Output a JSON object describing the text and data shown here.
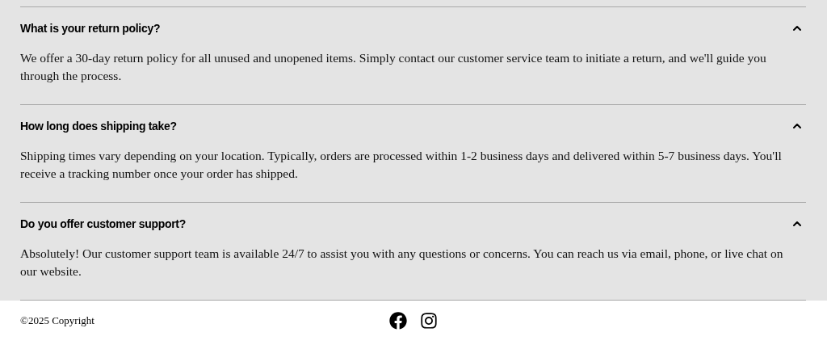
{
  "faq": [
    {
      "question": "What is your return policy?",
      "answer": "We offer a 30-day return policy for all unused and unopened items. Simply contact our customer service team to initiate a return, and we'll guide you through the process.",
      "expanded": true
    },
    {
      "question": "How long does shipping take?",
      "answer": "Shipping times vary depending on your location. Typically, orders are processed within 1-2 business days and delivered within 5-7 business days. You'll receive a tracking number once your order has shipped.",
      "expanded": true
    },
    {
      "question": "Do you offer customer support?",
      "answer": "Absolutely! Our customer support team is available 24/7 to assist you with any questions or concerns. You can reach us via email, phone, or live chat on our website.",
      "expanded": true
    }
  ],
  "footer": {
    "copyright": "©2025 Copyright",
    "social": [
      {
        "kind": "facebook"
      },
      {
        "kind": "instagram"
      }
    ]
  }
}
